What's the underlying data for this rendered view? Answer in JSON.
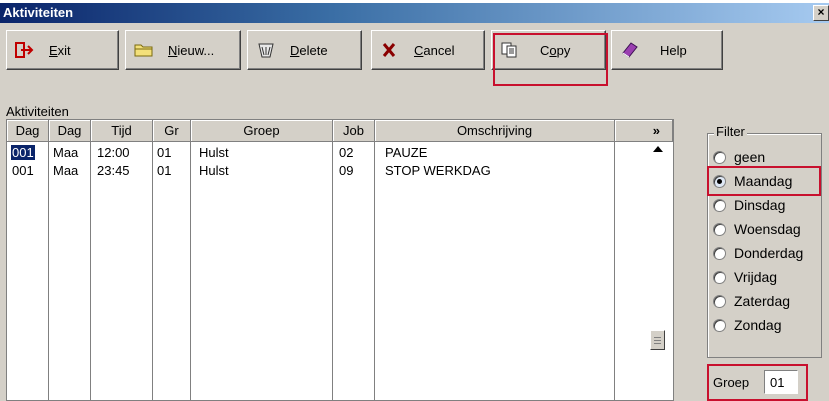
{
  "window": {
    "title": "Aktiviteiten",
    "close_label": "×"
  },
  "toolbar": {
    "exit": {
      "label_underline": "E",
      "label_rest": "xit",
      "icon": "exit-arrow-icon"
    },
    "nieuw": {
      "label_underline": "N",
      "label_rest": "ieuw...",
      "icon": "folder-icon"
    },
    "delete": {
      "label_underline": "D",
      "label_rest": "elete",
      "icon": "trash-icon"
    },
    "cancel": {
      "label_underline": "C",
      "label_rest": "ancel",
      "icon": "x-icon"
    },
    "copy": {
      "label_pre": "C",
      "label_underline": "o",
      "label_rest": "py",
      "icon": "copy-icon"
    },
    "help": {
      "label": "Help",
      "icon": "help-book-icon"
    }
  },
  "grid": {
    "caption": "Aktiviteiten",
    "columns": [
      "Dag",
      "Dag",
      "Tijd",
      "Gr",
      "Groep",
      "Job",
      "Omschrijving",
      "»"
    ],
    "rows": [
      {
        "dag": "001",
        "dagnaam": "Maa",
        "tijd": "12:00",
        "gr": "01",
        "groep": "Hulst",
        "job": "02",
        "omschrijving": "PAUZE"
      },
      {
        "dag": "001",
        "dagnaam": "Maa",
        "tijd": "23:45",
        "gr": "01",
        "groep": "Hulst",
        "job": "09",
        "omschrijving": "STOP WERKDAG"
      }
    ]
  },
  "filter": {
    "legend": "Filter",
    "options": [
      "geen",
      "Maandag",
      "Dinsdag",
      "Woensdag",
      "Donderdag",
      "Vrijdag",
      "Zaterdag",
      "Zondag"
    ],
    "selected": "Maandag"
  },
  "groep": {
    "label": "Groep",
    "value": "01"
  },
  "colors": {
    "highlight": "#c8102e",
    "selection": "#0a246a",
    "face": "#d4d0c8"
  }
}
